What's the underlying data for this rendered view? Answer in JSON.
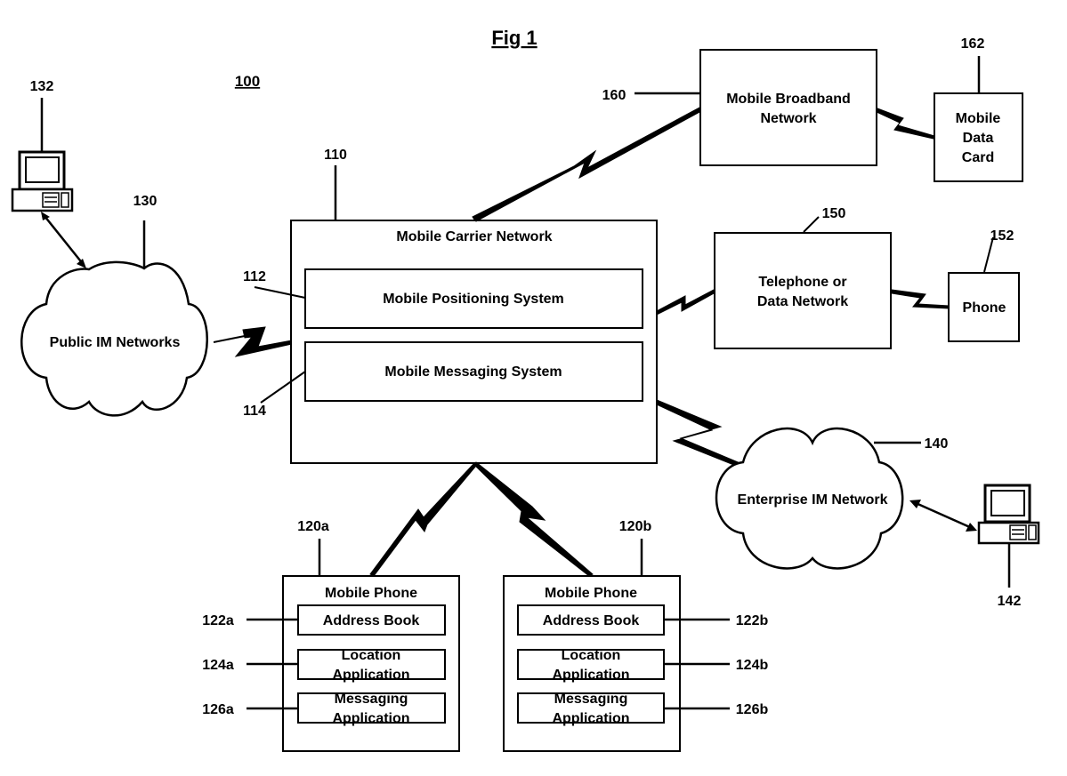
{
  "figure": {
    "title": "Fig 1",
    "reference": "100"
  },
  "nodes": {
    "carrier": {
      "ref": "110",
      "label": "Mobile Carrier Network"
    },
    "positioning": {
      "ref": "112",
      "label": "Mobile Positioning System"
    },
    "messaging": {
      "ref": "114",
      "label": "Mobile Messaging System"
    },
    "public_im": {
      "ref": "130",
      "label": "Public IM Networks"
    },
    "public_pc": {
      "ref": "132"
    },
    "enterprise_im": {
      "ref": "140",
      "label": "Enterprise IM Network"
    },
    "enterprise_pc": {
      "ref": "142"
    },
    "telephone": {
      "ref": "150",
      "label_line1": "Telephone or",
      "label_line2": "Data Network"
    },
    "phone": {
      "ref": "152",
      "label": "Phone"
    },
    "broadband": {
      "ref": "160",
      "label_line1": "Mobile Broadband",
      "label_line2": "Network"
    },
    "datacard": {
      "ref": "162",
      "label_line1": "Mobile",
      "label_line2": "Data",
      "label_line3": "Card"
    },
    "phone_a": {
      "ref": "120a",
      "label": "Mobile Phone",
      "address_book": {
        "ref": "122a",
        "label": "Address Book"
      },
      "location_app": {
        "ref": "124a",
        "line1": "Location",
        "line2": "Application"
      },
      "messaging_app": {
        "ref": "126a",
        "line1": "Messaging",
        "line2": "Application"
      }
    },
    "phone_b": {
      "ref": "120b",
      "label": "Mobile Phone",
      "address_book": {
        "ref": "122b",
        "label": "Address Book"
      },
      "location_app": {
        "ref": "124b",
        "line1": "Location",
        "line2": "Application"
      },
      "messaging_app": {
        "ref": "126b",
        "line1": "Messaging",
        "line2": "Application"
      }
    }
  }
}
